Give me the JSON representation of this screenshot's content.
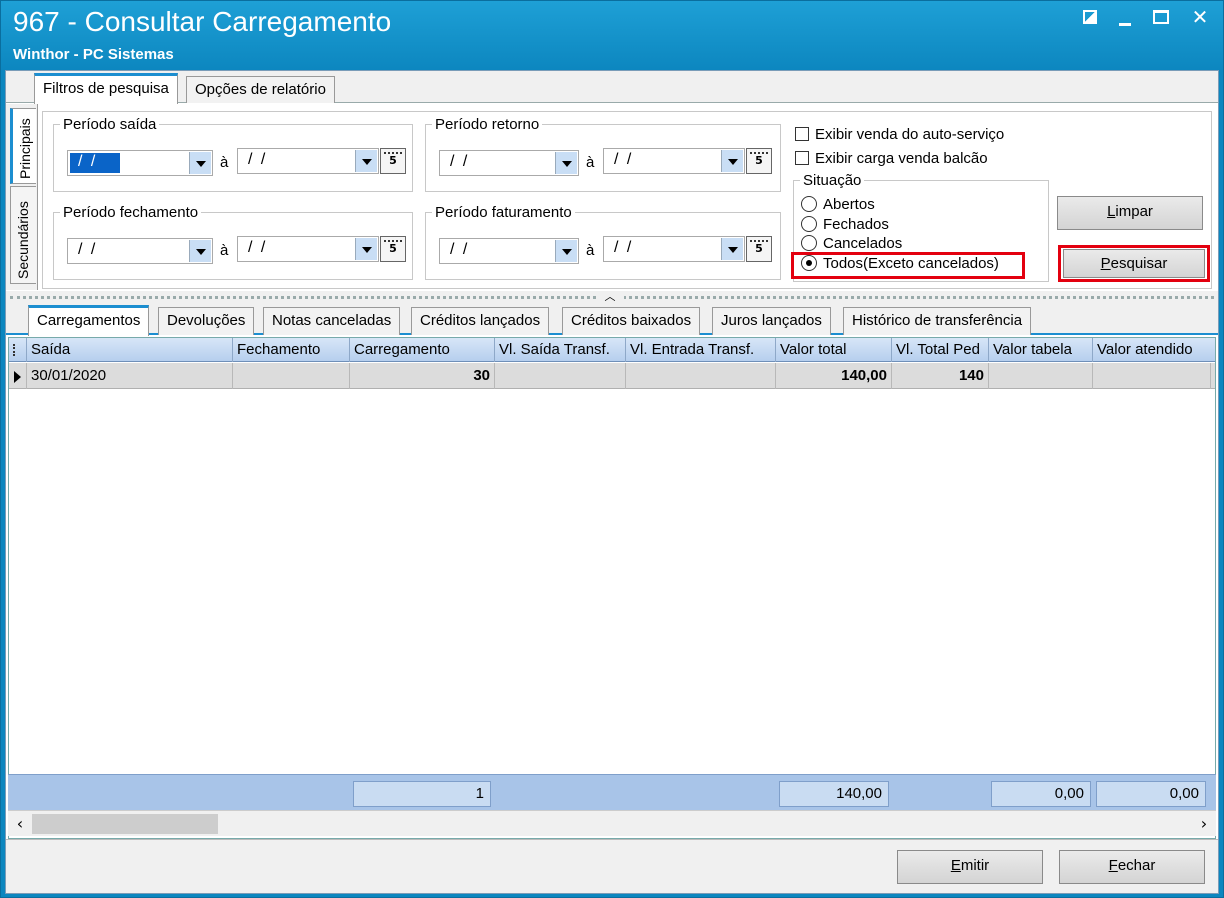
{
  "window": {
    "title": "967 - Consultar Carregamento",
    "subtitle": "Winthor - PC Sistemas"
  },
  "top_tabs": [
    "Filtros de pesquisa",
    "Opções de relatório"
  ],
  "side_tabs": [
    "Principais",
    "Secundários"
  ],
  "filters": {
    "periodo_saida": {
      "label": "Período saída",
      "from": "/ /",
      "to": "/ /"
    },
    "periodo_retorno": {
      "label": "Período retorno",
      "from": "/ /",
      "to": "/ /"
    },
    "periodo_fechamento": {
      "label": "Período fechamento",
      "from": "/ /",
      "to": "/ /"
    },
    "periodo_faturamento": {
      "label": "Período faturamento",
      "from": "/ /",
      "to": "/ /"
    },
    "separator": "à",
    "exibir_auto_servico": "Exibir venda do auto-serviço",
    "exibir_carga_balcao": "Exibir carga venda balcão",
    "situacao": {
      "label": "Situação",
      "options": [
        "Abertos",
        "Fechados",
        "Cancelados",
        "Todos(Exceto cancelados)"
      ],
      "selected": "Todos(Exceto cancelados)"
    },
    "limpar_prefix": "L",
    "limpar_rest": "impar",
    "pesquisar_prefix": "P",
    "pesquisar_rest": "esquisar"
  },
  "result_tabs": [
    "Carregamentos",
    "Devoluções",
    "Notas canceladas",
    "Créditos lançados",
    "Créditos baixados",
    "Juros lançados",
    "Histórico de transferência"
  ],
  "grid": {
    "columns": [
      "Saída",
      "Fechamento",
      "Carregamento",
      "Vl. Saída Transf.",
      "Vl. Entrada Transf.",
      "Valor total",
      "Vl. Total Ped",
      "Valor tabela",
      "Valor atendido"
    ],
    "rows": [
      {
        "saida": "30/01/2020",
        "fechamento": "",
        "carregamento": "30",
        "vl_saida": "",
        "vl_entrada": "",
        "valor_total": "140,00",
        "vl_total_ped": "140",
        "valor_tabela": "",
        "valor_atendido": ""
      }
    ],
    "footer": {
      "carregamento": "1",
      "valor_total": "140,00",
      "valor_tabela": "0,00",
      "valor_atendido": "0,00"
    }
  },
  "buttons": {
    "emitir_prefix": "E",
    "emitir_rest": "mitir",
    "fechar_prefix": "F",
    "fechar_rest": "echar"
  },
  "colors": {
    "title_bar": "#0c86bf",
    "accent": "#1c8ed0",
    "highlight": "#e3000f",
    "grid_header": "#b6cfee"
  }
}
